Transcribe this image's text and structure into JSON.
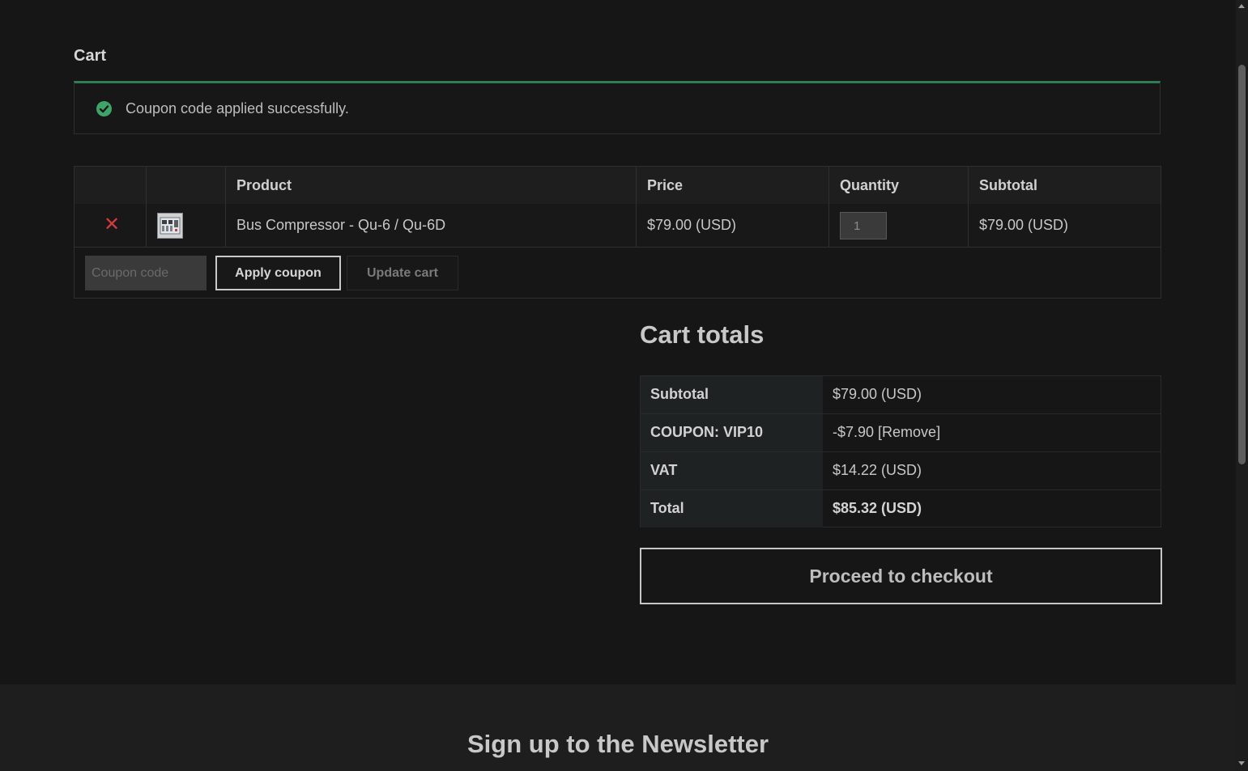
{
  "page": {
    "title": "Cart"
  },
  "notice": {
    "icon": "check-circle-icon",
    "text": "Coupon code applied successfully."
  },
  "cart": {
    "columns": [
      "",
      "",
      "Product",
      "Price",
      "Quantity",
      "Subtotal"
    ],
    "items": [
      {
        "remove_icon": "close-icon",
        "product": "Bus Compressor - Qu-6 / Qu-6D",
        "price": "$79.00 (USD)",
        "quantity": "1",
        "subtotal": "$79.00 (USD)"
      }
    ],
    "coupon": {
      "placeholder": "Coupon code",
      "value": "",
      "apply_label": "Apply coupon",
      "update_label": "Update cart"
    }
  },
  "totals": {
    "title": "Cart totals",
    "rows": [
      {
        "label": "Subtotal",
        "value": "$79.00 (USD)"
      },
      {
        "label": "COUPON: VIP10",
        "value": "-$7.90 [Remove]"
      },
      {
        "label": "VAT",
        "value": "$14.22 (USD)"
      },
      {
        "label": "Total",
        "value": "$85.32 (USD)"
      }
    ],
    "checkout_label": "Proceed to checkout"
  },
  "footer": {
    "newsletter_title": "Sign up to the Newsletter"
  },
  "colors": {
    "background": "#161616",
    "success": "#3fa468",
    "notice_border": "#2f7d55",
    "remove": "#d43b3b"
  }
}
